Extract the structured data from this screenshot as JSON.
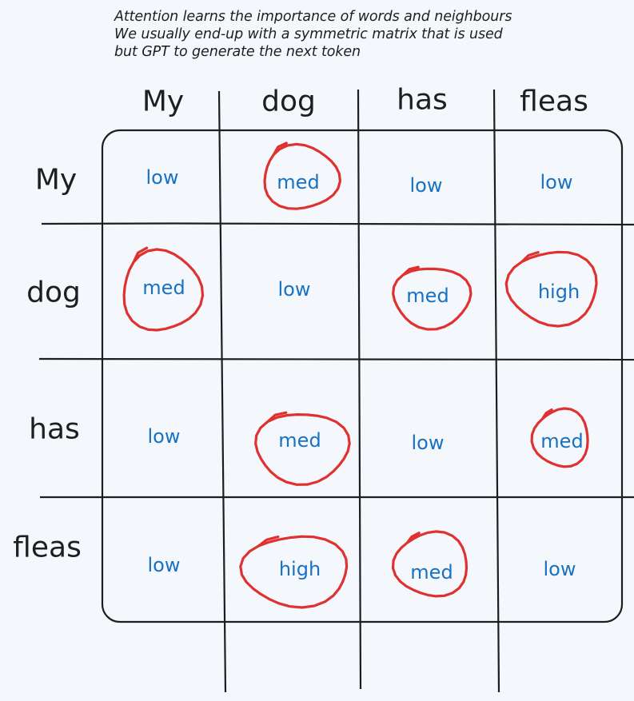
{
  "notes": [
    "Attention learns the importance of words and neighbours",
    "We usually end-up with a symmetric matrix that is used",
    "but GPT to generate the next token"
  ],
  "columns": [
    "My",
    "dog",
    "has",
    "fleas"
  ],
  "rows": [
    {
      "label": "My",
      "cells": [
        {
          "text": "low",
          "circled": false
        },
        {
          "text": "med",
          "circled": true
        },
        {
          "text": "low",
          "circled": false
        },
        {
          "text": "low",
          "circled": false
        }
      ]
    },
    {
      "label": "dog",
      "cells": [
        {
          "text": "med",
          "circled": true
        },
        {
          "text": "low",
          "circled": false
        },
        {
          "text": "med",
          "circled": true
        },
        {
          "text": "high",
          "circled": true
        }
      ]
    },
    {
      "label": "has",
      "cells": [
        {
          "text": "low",
          "circled": false
        },
        {
          "text": "med",
          "circled": true
        },
        {
          "text": "low",
          "circled": false
        },
        {
          "text": "med",
          "circled": true
        }
      ]
    },
    {
      "label": "fleas",
      "cells": [
        {
          "text": "low",
          "circled": false
        },
        {
          "text": "high",
          "circled": true
        },
        {
          "text": "med",
          "circled": true
        },
        {
          "text": "low",
          "circled": false
        }
      ]
    }
  ],
  "colors": {
    "ink": "#1e1e1e",
    "value_text": "#1971c2",
    "circle": "#e03131",
    "background": "#f4f8fc"
  }
}
